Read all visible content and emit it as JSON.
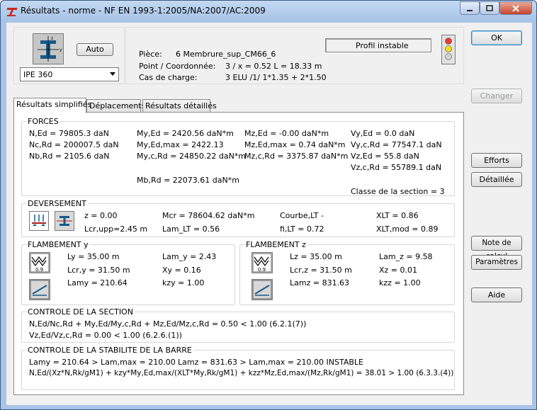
{
  "window": {
    "title": "Résultats - norme - NF EN 1993-1:2005/NA:2007/AC:2009"
  },
  "header": {
    "auto_label": "Auto",
    "profile_value": "IPE 360",
    "piece_label": "Pièce:",
    "piece_value": "6  Membrure_sup_CM66_6",
    "point_label": "Point / Coordonnée:",
    "point_value": "3 / x = 0.52 L = 18.33 m",
    "cas_label": "Cas de charge:",
    "cas_value": "3 ELU /1/  1*1.35 + 2*1.50",
    "status_text": "Profil instable"
  },
  "buttons": {
    "ok": "OK",
    "changer": "Changer",
    "efforts": "Efforts",
    "detaillee": "Détaillée",
    "note": "Note de calcul",
    "parametres": "Paramètres",
    "aide": "Aide"
  },
  "tabs": [
    {
      "label": "Résultats simplifiés"
    },
    {
      "label": "Déplacements"
    },
    {
      "label": "Résultats détaillés"
    }
  ],
  "forces": {
    "title": "FORCES",
    "c1": [
      "N,Ed = 79805.3 daN",
      "Nc,Rd = 200007.5 daN",
      "Nb,Rd = 2105.6 daN"
    ],
    "c2": [
      "My,Ed = 2420.56 daN*m",
      "My,Ed,max = 2422.13",
      "My,c,Rd = 24850.22 daN*m"
    ],
    "c3": [
      "Mz,Ed = -0.00 daN*m",
      "Mz,Ed,max = 0.74 daN*m",
      "Mz,c,Rd = 3375.87 daN*m"
    ],
    "c4": [
      "Vy,Ed = 0.0 daN",
      "Vy,c,Rd = 77547.1 daN",
      "Vz,Ed = 55.8 daN",
      "Vz,c,Rd = 55789.1 daN"
    ],
    "mb": "Mb,Rd = 22073.61 daN*m",
    "classe": "Classe de la section = 3"
  },
  "deversement": {
    "title": "DEVERSEMENT",
    "z": "z = 0.00",
    "lcr": "Lcr,upp=2.45 m",
    "mcr": "Mcr = 78604.62 daN*m",
    "lam": "Lam_LT = 0.56",
    "courbe": "Courbe,LT -",
    "fi": "fi,LT = 0.72",
    "xlt": "XLT = 0.86",
    "xltmod": "XLT,mod = 0.89"
  },
  "flamb_y": {
    "title": "FLAMBEMENT y",
    "coef": "0.9",
    "l": "Ly = 35.00 m",
    "lcr": "Lcr,y = 31.50 m",
    "lam": "Lamy = 210.64",
    "lam2": "Lam_y = 2.43",
    "x": "Xy = 0.16",
    "k": "kzy = 1.00"
  },
  "flamb_z": {
    "title": "FLAMBEMENT z",
    "coef": "0.9",
    "l": "Lz = 35.00 m",
    "lcr": "Lcr,z = 31.50 m",
    "lam": "Lamz = 831.63",
    "lam2": "Lam_z = 9.58",
    "x": "Xz = 0.01",
    "k": "kzz = 1.00"
  },
  "controle_section": {
    "title": "CONTROLE DE LA SECTION",
    "l1": "N,Ed/Nc,Rd + My,Ed/My,c,Rd + Mz,Ed/Mz,c,Rd = 0.50 < 1.00   (6.2.1(7))",
    "l2": "Vz,Ed/Vz,c,Rd = 0.00 < 1.00   (6.2.6.(1))"
  },
  "controle_stabilite": {
    "title": "CONTROLE DE LA STABILITE DE LA BARRE",
    "l1a": "Lamy = 210.64 > Lam,max = 210.00",
    "l1b": "Lamz = 831.63 > Lam,max = 210.00    INSTABLE",
    "l2": "N,Ed/(Xz*N,Rk/gM1) + kzy*My,Ed,max/(XLT*My,Rk/gM1) + kzz*Mz,Ed,max/(Mz,Rk/gM1) = 38.01 > 1.00   (6.3.3.(4))"
  },
  "colors": {
    "title_bar": "#a9c4e6",
    "close": "#c5442b",
    "traffic_red": "#e53935",
    "traffic_yellow": "#f1e01f",
    "traffic_green_off": "#cfd4cf"
  }
}
